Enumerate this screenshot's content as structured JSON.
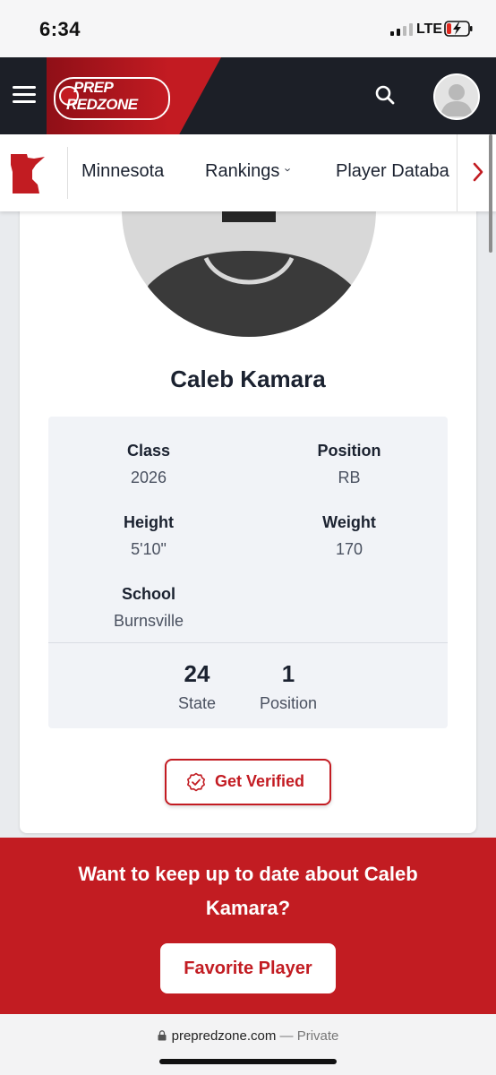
{
  "status": {
    "time": "6:34",
    "network": "LTE"
  },
  "header": {
    "logo_line1": "PREP",
    "logo_line2": "REDZONE"
  },
  "nav": {
    "items": [
      {
        "label": "Minnesota"
      },
      {
        "label": "Rankings",
        "chevron": "›"
      },
      {
        "label": "Player Databa"
      }
    ]
  },
  "player": {
    "name": "Caleb Kamara",
    "fields": {
      "class_label": "Class",
      "class_value": "2026",
      "position_label": "Position",
      "position_value": "RB",
      "height_label": "Height",
      "height_value": "5'10\"",
      "weight_label": "Weight",
      "weight_value": "170",
      "school_label": "School",
      "school_value": "Burnsville"
    },
    "rankings": [
      {
        "value": "24",
        "label": "State"
      },
      {
        "value": "1",
        "label": "Position"
      }
    ],
    "verify_label": "Get Verified"
  },
  "cta": {
    "text": "Want to keep up to date about Caleb Kamara?",
    "button_label": "Favorite Player"
  },
  "browser": {
    "domain": "prepredzone.com",
    "separator": "—",
    "private_label": "Private"
  },
  "colors": {
    "brand_red": "#c21c22",
    "header_dark": "#1c1f27",
    "panel_bg": "#f1f3f7"
  },
  "icons": [
    "menu-icon",
    "search-icon",
    "user-avatar-icon",
    "minnesota-map-icon",
    "chevron-right-icon",
    "check-badge-icon",
    "lock-icon",
    "battery-charging-icon"
  ]
}
